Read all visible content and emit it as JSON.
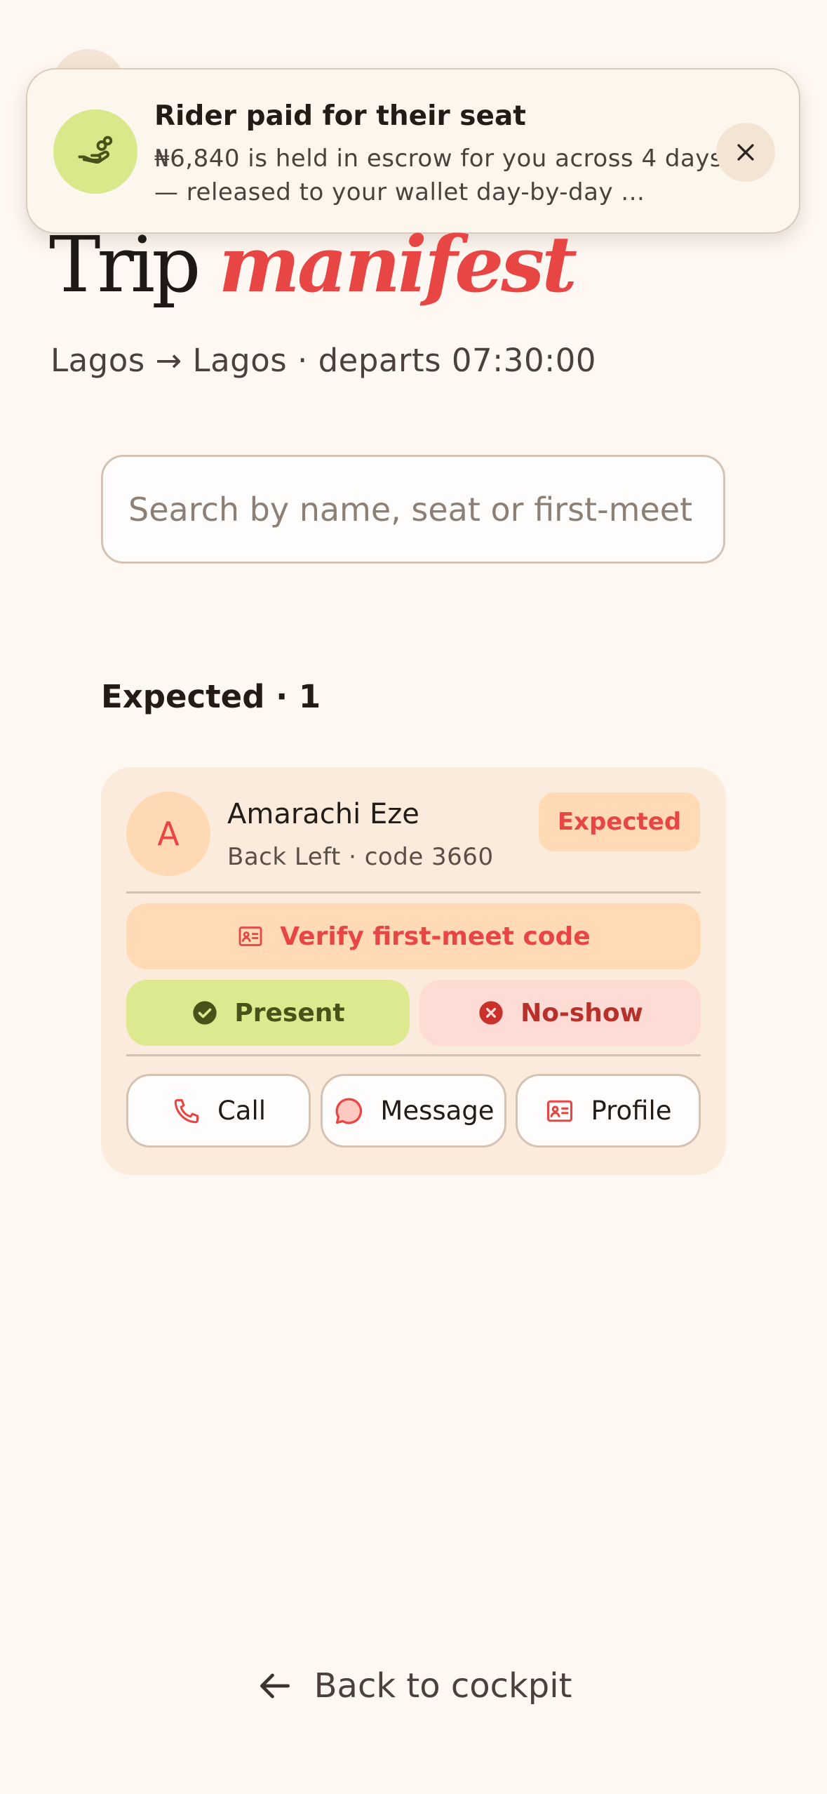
{
  "toast": {
    "title": "Rider paid for their seat",
    "message": "₦6,840 is held in escrow for you across 4 days — released to your wallet day-by-day ...",
    "icon": "hand-coins-icon",
    "close_icon": "close-icon"
  },
  "page": {
    "title_plain": "Trip",
    "title_accent": "manifest",
    "route": "Lagos → Lagos · departs 07:30:00"
  },
  "search": {
    "placeholder": "Search by name, seat or first-meet code",
    "value": ""
  },
  "section": {
    "label": "Expected · 1"
  },
  "rider": {
    "initial": "A",
    "name": "Amarachi Eze",
    "meta": "Back Left · code 3660",
    "status": "Expected"
  },
  "actions": {
    "verify": "Verify first-meet code",
    "present": "Present",
    "no_show": "No-show",
    "call": "Call",
    "message": "Message",
    "profile": "Profile"
  },
  "footer": {
    "back": "Back to cockpit"
  },
  "colors": {
    "background": "#fff7f1",
    "accent": "#e84545",
    "present_bg": "#dce98f",
    "noshow_bg": "#ffdbd6",
    "card_bg": "#faebdc"
  }
}
